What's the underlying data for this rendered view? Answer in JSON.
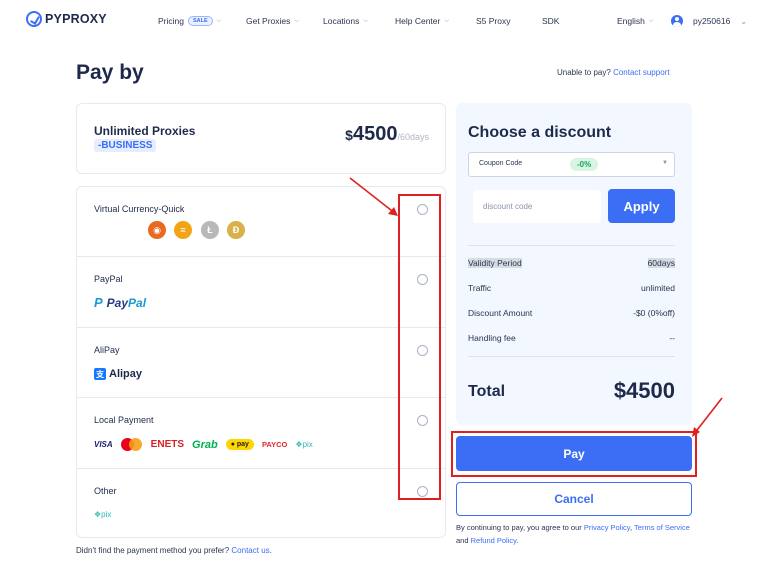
{
  "nav": {
    "brand": "PYPROXY",
    "items": [
      {
        "label": "Pricing",
        "badge": "SALE"
      },
      {
        "label": "Get Proxies"
      },
      {
        "label": "Locations"
      },
      {
        "label": "Help Center"
      },
      {
        "label": "S5 Proxy"
      },
      {
        "label": "SDK"
      }
    ],
    "language": "English",
    "username": "py250616"
  },
  "page": {
    "title": "Pay by",
    "unable_text": "Unable to pay?",
    "contact_support": "Contact support"
  },
  "product": {
    "name": "Unlimited Proxies",
    "tag": "-BUSINESS",
    "currency": "$",
    "price": "4500",
    "period": "/60days"
  },
  "methods": [
    {
      "label": "Virtual Currency-Quick",
      "icons": [
        "shiba-coin-icon",
        "usdt-coin-icon",
        "litecoin-icon",
        "dogecoin-icon"
      ]
    },
    {
      "label": "PayPal",
      "logo_a": "Pay",
      "logo_b": "Pal"
    },
    {
      "label": "AliPay",
      "logo": "Alipay"
    },
    {
      "label": "Local Payment",
      "logos": [
        "VISA",
        "ENETS",
        "Grab",
        "pay",
        "PAYCO",
        "pix"
      ]
    },
    {
      "label": "Other",
      "logo": "pix"
    }
  ],
  "discount": {
    "title": "Choose a discount",
    "coupon_label": "Coupon Code",
    "coupon_value": "-0%",
    "code_placeholder": "discount code",
    "apply_label": "Apply",
    "rows": [
      {
        "label": "Validity Period",
        "value": "60days"
      },
      {
        "label": "Traffic",
        "value": "unlimited"
      },
      {
        "label": "Discount Amount",
        "value": "-$0 (0%off)"
      },
      {
        "label": "Handling fee",
        "value": "--"
      }
    ],
    "total_label": "Total",
    "total_value": "$4500"
  },
  "actions": {
    "pay_label": "Pay",
    "cancel_label": "Cancel"
  },
  "terms": {
    "prefix": "By continuing to pay, you agree to our",
    "privacy": "Privacy Policy",
    "comma": ",",
    "tos": "Terms of Service",
    "and": "and",
    "refund": "Refund Policy",
    "end": "."
  },
  "bottom_note": {
    "text": "Didn't find the payment method you prefer?",
    "link": "Contact us",
    "end": "."
  },
  "colors": {
    "accent": "#3b6ef5",
    "annotation": "#e02020",
    "panel_bg": "#f3f7ff",
    "discount_badge": "#1aa55a"
  }
}
